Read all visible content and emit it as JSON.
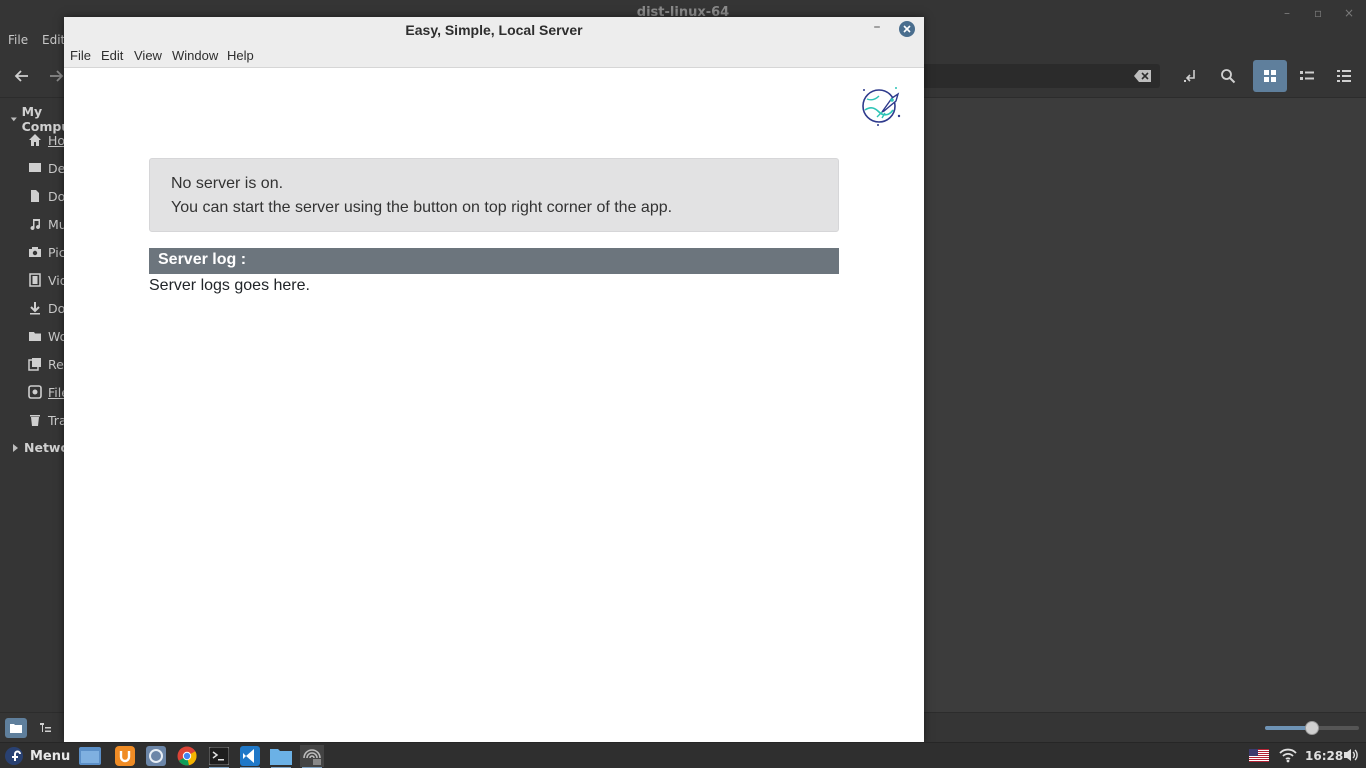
{
  "file_manager": {
    "title": "dist-linux-64",
    "menu": [
      "File",
      "Edit"
    ],
    "sidebar": {
      "my_computer": "My Computer",
      "items": [
        {
          "label": "Home",
          "icon": "home-icon"
        },
        {
          "label": "Desktop",
          "icon": "desktop-icon"
        },
        {
          "label": "Documents",
          "icon": "document-icon"
        },
        {
          "label": "Music",
          "icon": "music-icon"
        },
        {
          "label": "Pictures",
          "icon": "camera-icon"
        },
        {
          "label": "Videos",
          "icon": "film-icon"
        },
        {
          "label": "Downloads",
          "icon": "download-icon"
        },
        {
          "label": "Workspace",
          "icon": "folder-icon"
        },
        {
          "label": "Recent",
          "icon": "recent-icon"
        },
        {
          "label": "File System",
          "icon": "drive-icon"
        },
        {
          "label": "Trash",
          "icon": "trash-icon"
        }
      ],
      "network": "Network"
    },
    "zoom_level": 0.5
  },
  "app": {
    "title": "Easy, Simple, Local Server",
    "menu": [
      "File",
      "Edit",
      "View",
      "Window",
      "Help"
    ],
    "notice": {
      "line1": "No server is on.",
      "line2": "You can start the server using the button on top right corner of the app."
    },
    "log": {
      "header": "Server log :",
      "body": "Server logs goes here."
    }
  },
  "taskbar": {
    "menu_label": "Menu",
    "clock": "16:28",
    "launchers": [
      "files-icon",
      "firefox-icon",
      "settings-icon",
      "chrome-icon",
      "terminal-icon",
      "vscode-icon",
      "folder-icon",
      "server-app-icon"
    ]
  },
  "colors": {
    "accent": "#5f7f9c",
    "log_header_bg": "#6c757d",
    "notice_bg": "#e2e2e3"
  }
}
